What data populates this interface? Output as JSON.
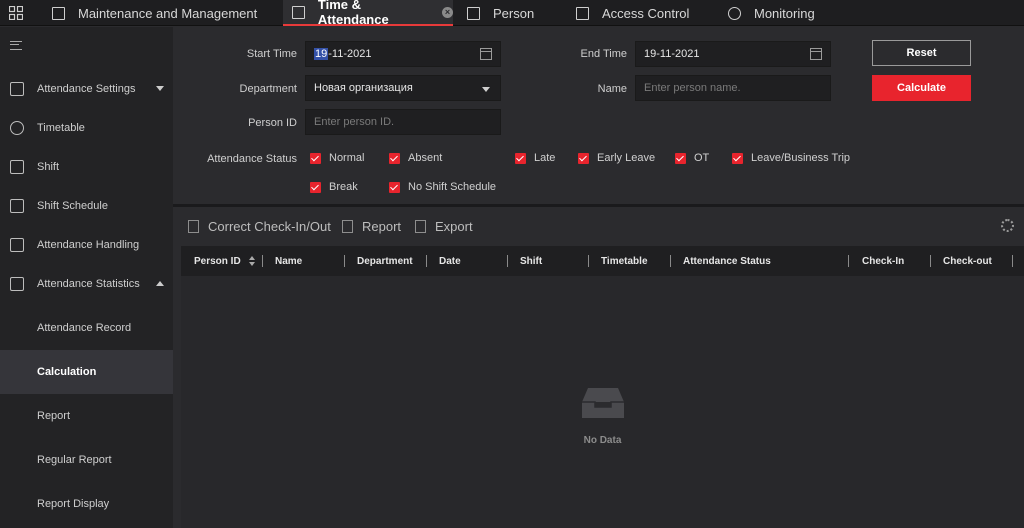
{
  "top_tabs": [
    {
      "label": "Maintenance and Management",
      "icon": "maintenance-icon"
    },
    {
      "label": "Time & Attendance",
      "icon": "calendar-icon",
      "active": true
    },
    {
      "label": "Person",
      "icon": "person-icon"
    },
    {
      "label": "Access Control",
      "icon": "access-control-icon"
    },
    {
      "label": "Monitoring",
      "icon": "monitoring-icon"
    }
  ],
  "sidebar": {
    "items": [
      {
        "label": "Attendance Settings",
        "icon": "settings-icon",
        "expandable": "down"
      },
      {
        "label": "Timetable",
        "icon": "clock-icon"
      },
      {
        "label": "Shift",
        "icon": "shift-icon"
      },
      {
        "label": "Shift Schedule",
        "icon": "schedule-icon"
      },
      {
        "label": "Attendance Handling",
        "icon": "handling-icon"
      },
      {
        "label": "Attendance Statistics",
        "icon": "statistics-icon",
        "expandable": "up"
      }
    ],
    "subitems": [
      {
        "label": "Attendance Record"
      },
      {
        "label": "Calculation",
        "active": true
      },
      {
        "label": "Report"
      },
      {
        "label": "Regular Report"
      },
      {
        "label": "Report Display"
      }
    ]
  },
  "filters": {
    "start_time_label": "Start Time",
    "start_time_hl": "19",
    "start_time_rest": "-11-2021",
    "end_time_label": "End Time",
    "end_time_value": "19-11-2021",
    "department_label": "Department",
    "department_value": "Новая организация",
    "name_label": "Name",
    "name_placeholder": "Enter person name.",
    "person_id_label": "Person ID",
    "person_id_placeholder": "Enter person ID.",
    "status_label": "Attendance Status",
    "statuses": [
      "Normal",
      "Absent",
      "Late",
      "Early Leave",
      "OT",
      "Leave/Business Trip",
      "Break",
      "No Shift Schedule"
    ],
    "reset_label": "Reset",
    "calculate_label": "Calculate"
  },
  "toolbar": {
    "correct_label": "Correct Check-In/Out",
    "report_label": "Report",
    "export_label": "Export"
  },
  "table": {
    "columns": [
      "Person ID",
      "Name",
      "Department",
      "Date",
      "Shift",
      "Timetable",
      "Attendance Status",
      "Check-In",
      "Check-out"
    ],
    "empty_text": "No Data"
  },
  "colors": {
    "accent": "#e8242d",
    "background": "#2b2b2e"
  }
}
